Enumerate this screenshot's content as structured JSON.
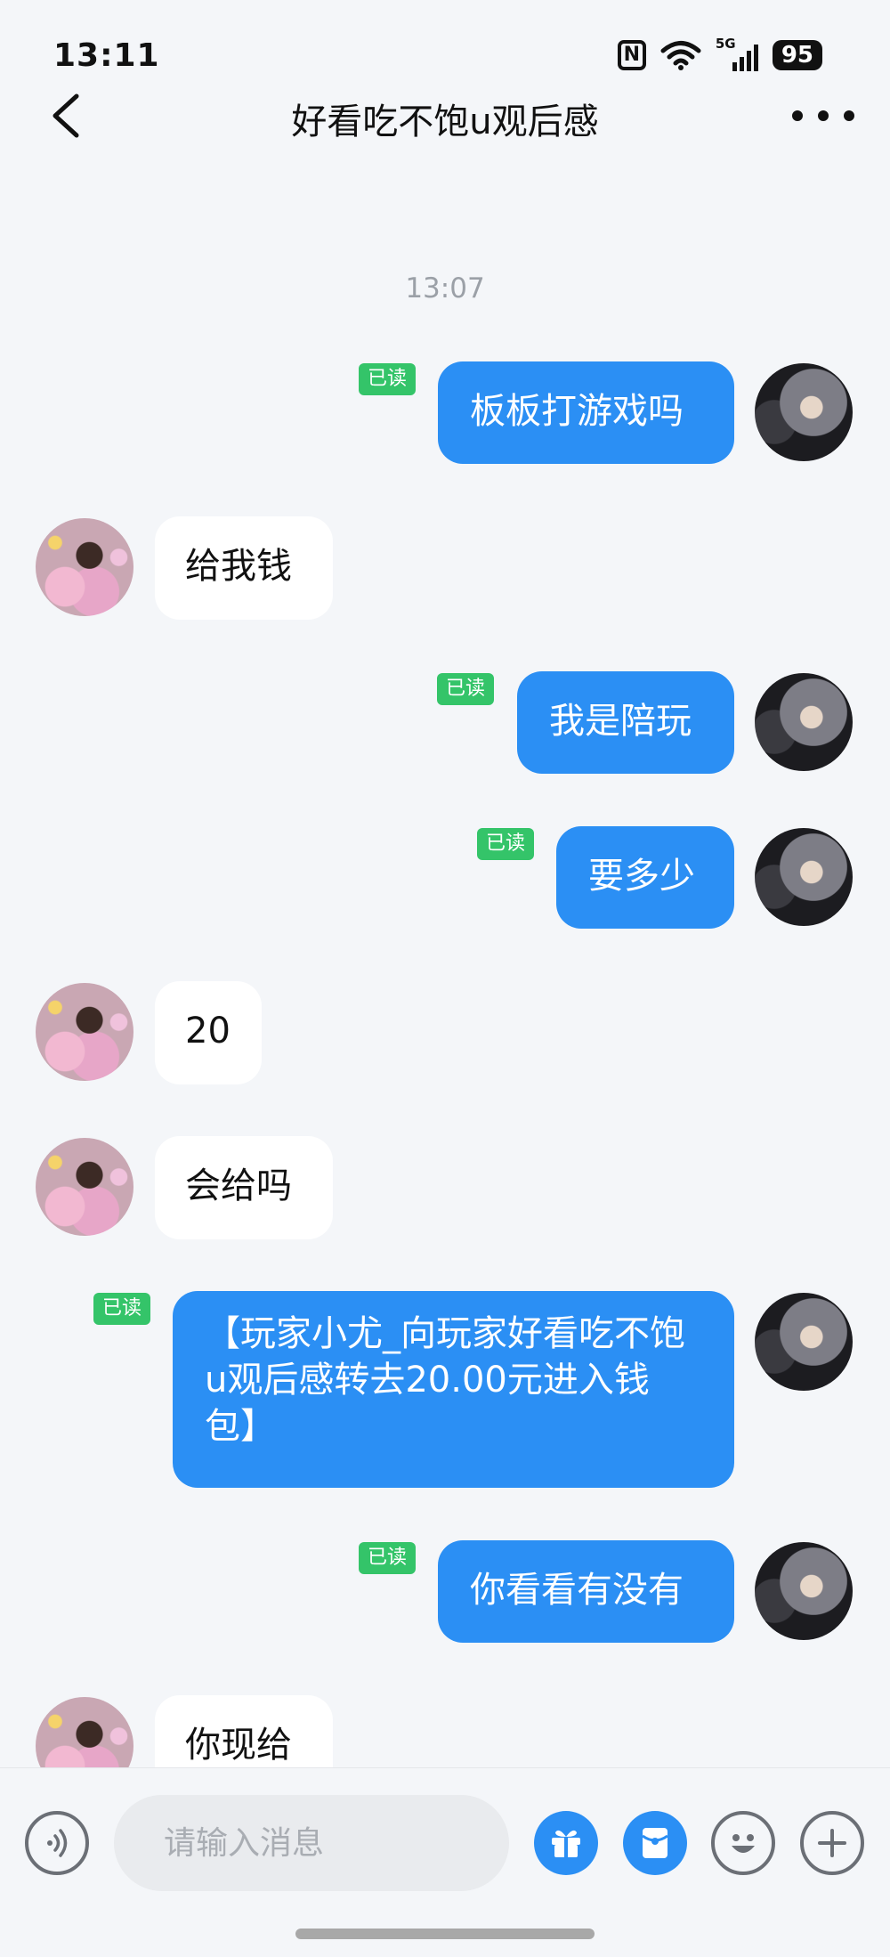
{
  "status_bar": {
    "time": "13:11",
    "nfc_label": "N",
    "network_label": "5G",
    "battery": "95"
  },
  "header": {
    "title": "好看吃不饱u观后感"
  },
  "chat": {
    "timestamp": "13:07",
    "read_label": "已读",
    "messages": [
      {
        "from": "self",
        "text": "板板打游戏吗",
        "read": true
      },
      {
        "from": "other",
        "text": "给我钱"
      },
      {
        "from": "self",
        "text": "我是陪玩",
        "read": true
      },
      {
        "from": "self",
        "text": "要多少",
        "read": true
      },
      {
        "from": "other",
        "text": "20"
      },
      {
        "from": "other",
        "text": "会给吗"
      },
      {
        "from": "self",
        "text": "【玩家小尤_向玩家好看吃不饱u观后感转去20.00元进入钱包】",
        "read": true
      },
      {
        "from": "self",
        "text": "你看看有没有",
        "read": true
      },
      {
        "from": "other",
        "text": "你现给"
      }
    ]
  },
  "input_bar": {
    "placeholder": "请输入消息",
    "icons": [
      "voice-icon",
      "gift-icon",
      "red-packet-icon",
      "emoji-icon",
      "plus-icon"
    ],
    "accent_color": "#2b8ff4"
  },
  "colors": {
    "outgoing_bubble": "#2b8ff4",
    "incoming_bubble": "#ffffff",
    "read_badge": "#34c469",
    "background": "#f4f6f9"
  }
}
